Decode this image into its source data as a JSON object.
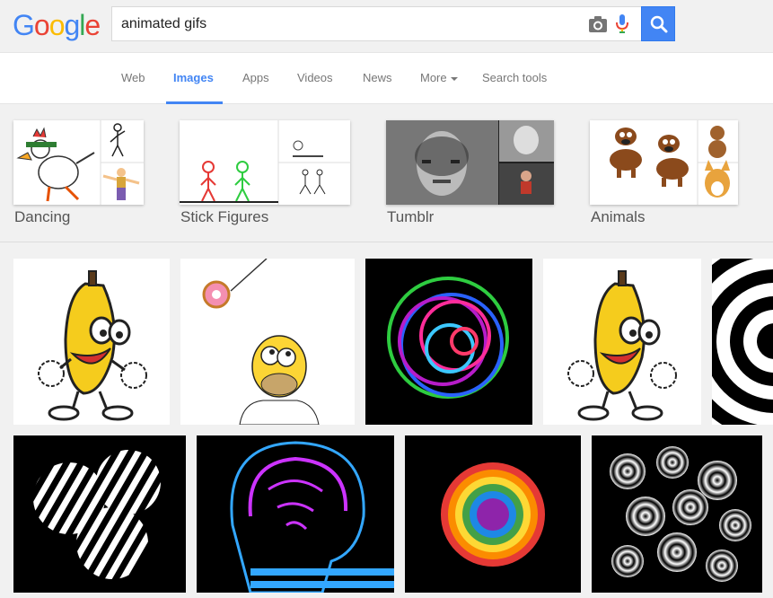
{
  "logo": {
    "letters": [
      "G",
      "o",
      "o",
      "g",
      "l",
      "e"
    ],
    "colors": [
      "#4285f4",
      "#ea4335",
      "#fbbc05",
      "#4285f4",
      "#34a853",
      "#ea4335"
    ]
  },
  "search": {
    "query": "animated gifs",
    "camera_icon": "camera-icon",
    "mic_icon": "microphone-icon",
    "button_icon": "search-icon"
  },
  "nav": {
    "items": [
      {
        "label": "Web",
        "active": false
      },
      {
        "label": "Images",
        "active": true
      },
      {
        "label": "Apps",
        "active": false
      },
      {
        "label": "Videos",
        "active": false
      },
      {
        "label": "News",
        "active": false
      },
      {
        "label": "More",
        "active": false
      },
      {
        "label": "Search tools",
        "active": false
      }
    ],
    "accent": "#4285f4"
  },
  "categories": [
    {
      "label": "Dancing"
    },
    {
      "label": "Stick Figures"
    },
    {
      "label": "Tumblr"
    },
    {
      "label": "Animals"
    }
  ],
  "results": {
    "row1": [
      "dancing-banana",
      "homer-donut",
      "neon-spiral",
      "dancing-banana",
      "black-white-spiral"
    ],
    "row2": [
      "striped-blob",
      "xray-skull",
      "rainbow-sphere",
      "striped-spheres"
    ]
  }
}
